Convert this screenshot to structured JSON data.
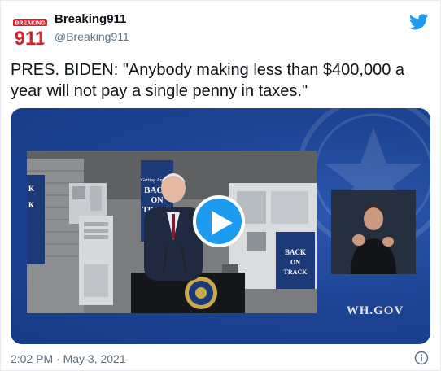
{
  "author": {
    "name": "Breaking911",
    "handle": "@Breaking911",
    "avatar_logo_text": "911",
    "avatar_logo_subtext": "BREAKING"
  },
  "tweet": {
    "text": "PRES. BIDEN: \"Anybody making less than $400,000 a year will not pay a single penny in taxes.\""
  },
  "media": {
    "type": "video",
    "watermark": "WH.GOV",
    "backdrop_sign_lines": [
      "BACK",
      "ON",
      "TRACK"
    ],
    "backdrop_sign_small": "Getting America",
    "play_icon": "play-icon"
  },
  "footer": {
    "timestamp": "2:02 PM · May 3, 2021",
    "info_icon": "info-icon"
  },
  "colors": {
    "twitter_blue": "#1d9bf0",
    "media_bg": "#1e4596",
    "text_primary": "#0f1419",
    "text_secondary": "#5b7083"
  }
}
